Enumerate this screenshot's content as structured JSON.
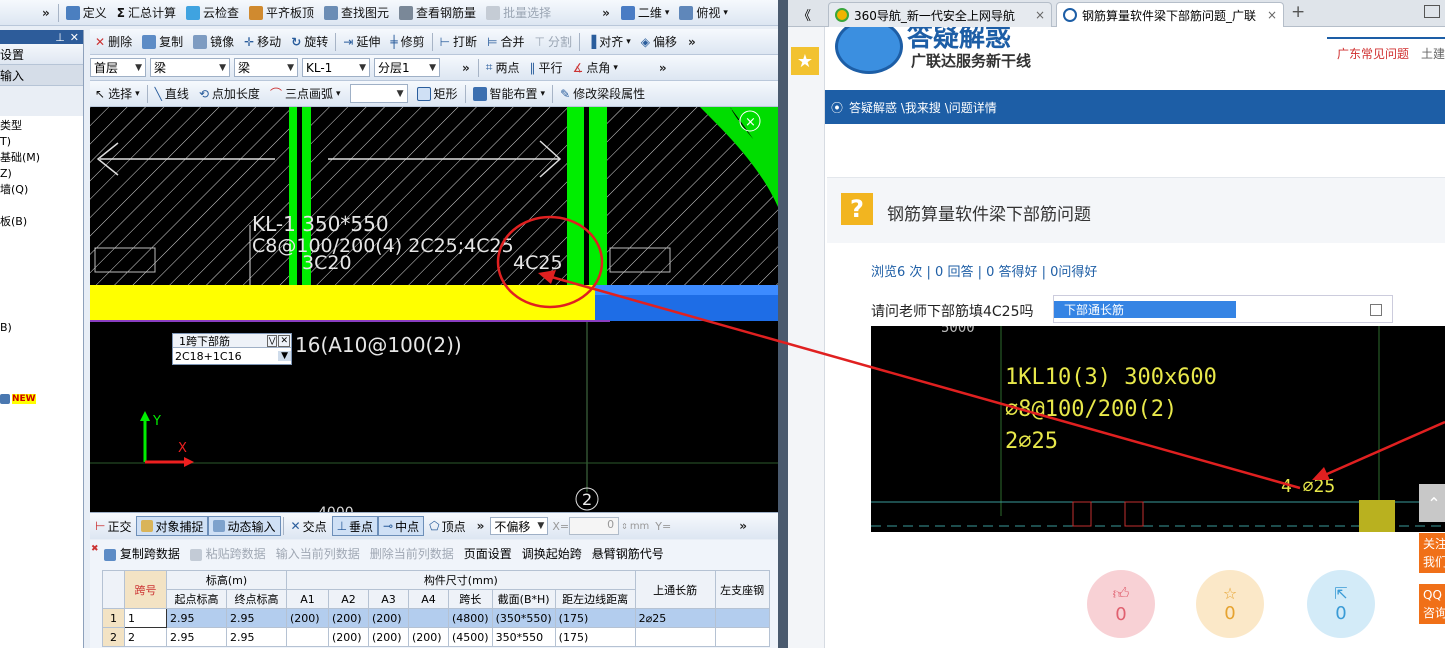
{
  "cad": {
    "toolbar1": {
      "chevron": "»",
      "items": [
        "定义",
        "汇总计算",
        "云检查",
        "平齐板顶",
        "查找图元",
        "查看钢筋量",
        "批量选择"
      ],
      "view2d": "二维",
      "view_mode": "俯视"
    },
    "toolbar2": {
      "items": [
        "删除",
        "复制",
        "镜像",
        "移动",
        "旋转",
        "延伸",
        "修剪",
        "打断",
        "合并",
        "分割",
        "对齐",
        "偏移"
      ]
    },
    "toolbar3": {
      "floor": "首层",
      "type1": "梁",
      "type2": "梁",
      "element": "KL-1",
      "layer": "分层1",
      "tools": [
        "两点",
        "平行",
        "点角"
      ]
    },
    "toolbar4": {
      "items": [
        "选择",
        "直线",
        "点加长度",
        "三点画弧",
        "矩形",
        "智能布置",
        "修改梁段属性"
      ]
    },
    "left_panel": {
      "buttons": [
        "设置",
        "输入"
      ],
      "items": [
        "类型",
        "T)",
        "基础(M)",
        "Z)",
        "墙(Q)",
        "",
        "板(B)",
        "",
        "",
        "",
        "",
        "",
        "",
        "",
        "B)"
      ],
      "new_badge": "NEW"
    },
    "drawing": {
      "beam_label_1": "KL-1 350*550",
      "beam_label_2": "C8@100/200(4) 2C25;4C25",
      "beam_label_3": "3C20",
      "bottom_label": "4C25",
      "stirrup_label": "16(A10@100(2))",
      "axis_x": "X",
      "axis_y": "Y",
      "axis_number": "2",
      "dim_text": "4000",
      "popup_title": "1跨下部筋",
      "popup_value": "2C18+1C16"
    },
    "snapbar": {
      "items": [
        "正交",
        "对象捕捉",
        "动态输入",
        "交点",
        "垂点",
        "中点",
        "顶点"
      ],
      "offset_mode": "不偏移",
      "x_label": "X=",
      "x_value": "0",
      "unit": "mm",
      "y_label": "Y="
    },
    "table_toolbar": [
      "复制跨数据",
      "粘贴跨数据",
      "输入当前列数据",
      "删除当前列数据",
      "页面设置",
      "调换起始跨",
      "悬臂钢筋代号"
    ],
    "table": {
      "headers_top": [
        "跨号",
        "标高(m)",
        "构件尺寸(mm)",
        "上通长筋",
        "左支座钢"
      ],
      "headers_sub": [
        "起点标高",
        "终点标高",
        "A1",
        "A2",
        "A3",
        "A4",
        "跨长",
        "截面(B*H)",
        "距左边线距离"
      ],
      "rows": [
        {
          "num": "1",
          "span": "1",
          "start": "2.95",
          "end": "2.95",
          "a1": "(200)",
          "a2": "(200)",
          "a3": "(200)",
          "a4": "",
          "len": "(4800)",
          "sec": "(350*550)",
          "dist": "(175)",
          "top": "2⌀25",
          "left": ""
        },
        {
          "num": "2",
          "span": "2",
          "start": "2.95",
          "end": "2.95",
          "a1": "",
          "a2": "(200)",
          "a3": "(200)",
          "a4": "(200)",
          "len": "(4500)",
          "sec": "350*550",
          "dist": "(175)",
          "top": "",
          "left": ""
        }
      ]
    }
  },
  "browser": {
    "tabs": [
      {
        "title": "360导航_新一代安全上网导航",
        "close": "×"
      },
      {
        "title": "钢筋算量软件梁下部筋问题_广联",
        "close": "×"
      }
    ],
    "new_tab": "+",
    "back": "《",
    "logo_title": "答疑解惑",
    "logo_subtitle": "广联达服务新干线",
    "top_link_1": "广东常见问题",
    "top_link_2": "土建",
    "breadcrumb": "答疑解惑 \\我来搜 \\问题详情",
    "question_title": "钢筋算量软件梁下部筋问题",
    "stats": "浏览6 次 | 0 回答 | 0 答得好 | 0问得好",
    "question_text": "请问老师下部筋填4C25吗",
    "embedded": {
      "dropdown_value": "下部通长筋",
      "top_ruler": "5000",
      "label_1": "1KL10(3) 300x600",
      "label_2": "⌀8@100/200(2)",
      "label_3": "2⌀25",
      "label_4": "4 ⌀25"
    },
    "reactions": [
      {
        "icon": "thumbs-up",
        "count": "0",
        "color": "#f6c7cc"
      },
      {
        "icon": "star",
        "count": "0",
        "color": "#fbe6bf"
      },
      {
        "icon": "share",
        "count": "0",
        "color": "#cde8f7"
      }
    ],
    "float_1": "关注我们",
    "float_2": "QQ咨询"
  },
  "colors": {
    "cad_bg": "#000000",
    "beam_yellow": "#ffff00",
    "column_green": "#00ee00",
    "blue_beam": "#1e6de6",
    "arrow_red": "#e02020",
    "site_blue": "#1d5ea6"
  }
}
